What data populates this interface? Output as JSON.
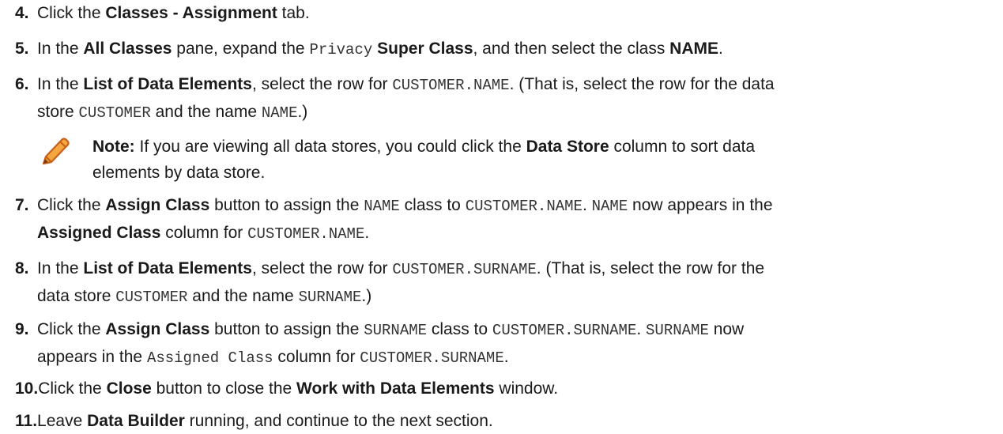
{
  "steps": [
    {
      "num": "4.",
      "parts": [
        "Click the ",
        "Classes - Assignment",
        " tab."
      ]
    },
    {
      "num": "5.",
      "parts": [
        "In the ",
        "All Classes",
        " pane, expand the ",
        "Privacy",
        " ",
        "Super Class",
        ", and then select the class ",
        "NAME",
        "."
      ]
    },
    {
      "num": "6.",
      "parts": [
        "In the ",
        "List of Data Elements",
        ", select the row for ",
        "CUSTOMER.NAME",
        ". (That is, select the row for the data",
        "store ",
        "CUSTOMER",
        " and the name ",
        "NAME",
        ".)"
      ]
    },
    {
      "num": "7.",
      "parts": [
        "Click the ",
        "Assign Class",
        " button to assign the ",
        "NAME",
        " class to ",
        "CUSTOMER.NAME",
        ". ",
        "NAME",
        " now appears in the",
        "Assigned Class",
        " column for ",
        "CUSTOMER.NAME",
        "."
      ]
    },
    {
      "num": "8.",
      "parts": [
        "In the ",
        "List of Data Elements",
        ", select the row for ",
        "CUSTOMER.SURNAME",
        ". (That is, select the row for the",
        "data store ",
        "CUSTOMER",
        " and the name ",
        "SURNAME",
        ".)"
      ]
    },
    {
      "num": "9.",
      "parts": [
        "Click the ",
        "Assign Class",
        " button to assign the ",
        "SURNAME",
        " class to ",
        "CUSTOMER.SURNAME",
        ". ",
        "SURNAME",
        " now",
        "appears in the ",
        "Assigned Class",
        " column for ",
        "CUSTOMER.SURNAME",
        "."
      ]
    },
    {
      "num": "10.",
      "parts": [
        "Click the ",
        "Close",
        " button to close the ",
        "Work with Data Elements",
        " window."
      ]
    },
    {
      "num": "11.",
      "parts": [
        "Leave ",
        "Data Builder",
        " running, and continue to the next section."
      ]
    }
  ],
  "note": {
    "label": "Note:",
    "parts": [
      " If you are viewing all data stores, you could click the ",
      "Data Store",
      " column to sort data",
      "elements by data store."
    ],
    "icon": "pencil-icon",
    "icon_color": "#e8731f"
  }
}
